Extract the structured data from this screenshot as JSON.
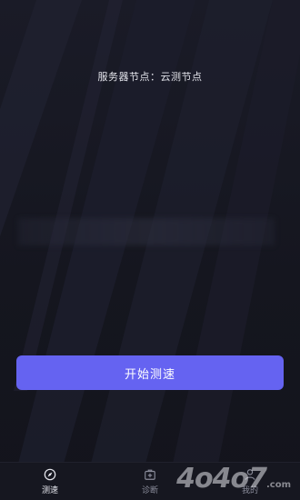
{
  "header": {
    "server_label": "服务器节点：",
    "server_value": "云测节点"
  },
  "actions": {
    "start_label": "开始测速"
  },
  "tabs": [
    {
      "label": "测速",
      "icon": "compass-icon",
      "active": true
    },
    {
      "label": "诊断",
      "icon": "medkit-icon",
      "active": false
    },
    {
      "label": "我的",
      "icon": "person-icon",
      "active": false
    }
  ],
  "watermark": {
    "brand": "4o4o7",
    "suffix": ".com"
  },
  "colors": {
    "accent": "#6563f1",
    "background": "#14151f",
    "tab_active": "#e6e7ee",
    "tab_inactive": "#8a8c9a"
  }
}
